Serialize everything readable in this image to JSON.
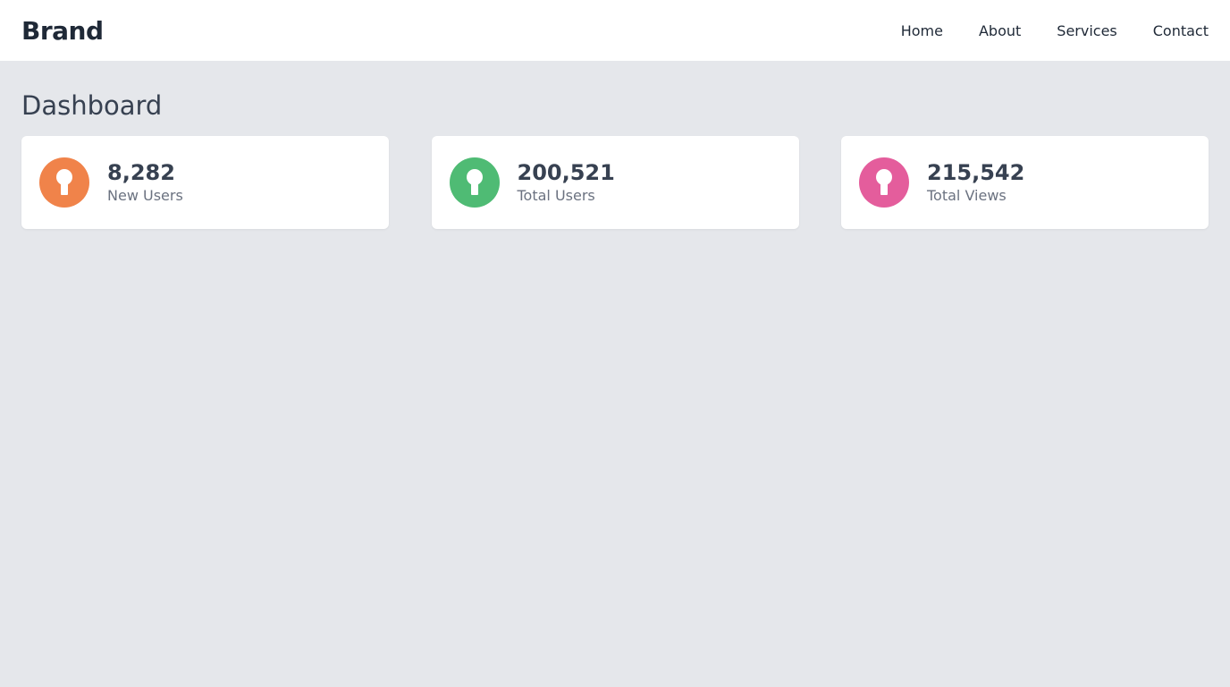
{
  "navbar": {
    "brand": "Brand",
    "links": [
      "Home",
      "About",
      "Services",
      "Contact"
    ]
  },
  "main": {
    "title": "Dashboard",
    "cards": [
      {
        "value": "8,282",
        "label": "New Users",
        "color": "#f0834a",
        "icon": "keyhole-icon"
      },
      {
        "value": "200,521",
        "label": "Total Users",
        "color": "#4fbb74",
        "icon": "keyhole-icon"
      },
      {
        "value": "215,542",
        "label": "Total Views",
        "color": "#e45d9c",
        "icon": "keyhole-icon"
      }
    ]
  }
}
